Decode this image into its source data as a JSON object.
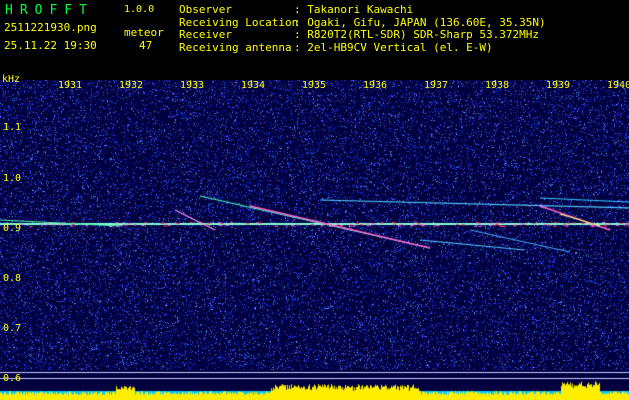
{
  "header": {
    "app_name": "HROFFT",
    "app_version": "1.0.0",
    "filename": "2511221930.png",
    "datetime": "25.11.22 19:30",
    "meteor_label": "meteor",
    "meteor_count": "47"
  },
  "station": [
    {
      "key": "Observer",
      "value": ": Takanori Kawachi"
    },
    {
      "key": "Receiving Location",
      "value": ": Ogaki, Gifu, JAPAN (136.60E, 35.35N)"
    },
    {
      "key": "Receiver",
      "value": ": R820T2(RTL-SDR) SDR-Sharp 53.372MHz"
    },
    {
      "key": "Receiving antenna",
      "value": ": 2el-HB9CV Vertical (el. E-W)"
    }
  ],
  "spectrogram": {
    "unit_label": "kHz",
    "y_ticks": [
      "1.1",
      "1.0",
      "0.9",
      "0.8",
      "0.7",
      "0.6"
    ],
    "y_values": [
      1.1,
      1.0,
      0.9,
      0.8,
      0.7,
      0.6
    ],
    "x_ticks": [
      "1931",
      "1932",
      "1933",
      "1934",
      "1935",
      "1936",
      "1937",
      "1938",
      "1939",
      "1940"
    ],
    "carrier_khz": 0.91,
    "colors": {
      "background": "#000040",
      "noise": "#2233ff",
      "echo": "#ff66cc",
      "level": "#ffee00",
      "base": "#00ccff",
      "text": "#ffff00"
    }
  }
}
